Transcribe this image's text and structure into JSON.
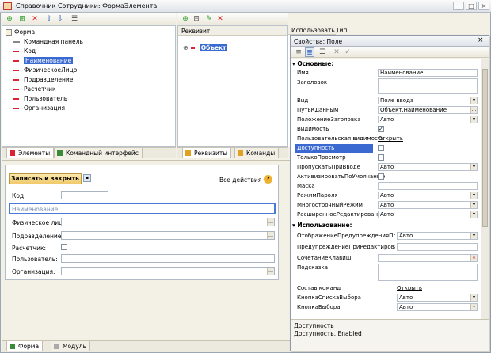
{
  "window": {
    "title": "Справочник Сотрудники: ФормаЭлемента",
    "buttons": [
      "_",
      "□",
      "×"
    ]
  },
  "elements_tree": {
    "root": "Форма",
    "items": [
      {
        "label": "Командная панель",
        "selected": false
      },
      {
        "label": "Код",
        "selected": false
      },
      {
        "label": "Наименование",
        "selected": true
      },
      {
        "label": "ФизическоеЛицо",
        "selected": false
      },
      {
        "label": "Подразделение",
        "selected": false
      },
      {
        "label": "Расчетчик",
        "selected": false
      },
      {
        "label": "Пользователь",
        "selected": false
      },
      {
        "label": "Организация",
        "selected": false
      }
    ]
  },
  "left_tabs": [
    "Элементы",
    "Командный интерфейс"
  ],
  "attributes": {
    "col_requisite": "Реквизит",
    "col_use": "Использовать",
    "col_type": "Тип",
    "item": "Объект"
  },
  "middle_tabs": [
    "Реквизиты",
    "Команды"
  ],
  "preview_form": {
    "save_button": "Записать и закрыть",
    "all_actions": "Все действия",
    "help": "?",
    "fields": [
      {
        "label": "Код:",
        "value": ""
      },
      {
        "label": "Наименование:",
        "value": ""
      },
      {
        "label": "Физическое лицо:",
        "value": ""
      },
      {
        "label": "Подразделение:",
        "value": ""
      },
      {
        "label": "Расчетчик:",
        "value": ""
      },
      {
        "label": "Пользователь:",
        "value": ""
      },
      {
        "label": "Организация:",
        "value": ""
      }
    ]
  },
  "bottom_tabs": [
    "Форма",
    "Модуль"
  ],
  "properties": {
    "title": "Свойства: Поле",
    "section_main": "Основные:",
    "section_use": "Использование:",
    "rows_main": [
      {
        "name": "Имя",
        "kind": "text",
        "value": "Наименование"
      },
      {
        "name": "Заголовок",
        "kind": "multiline",
        "value": ""
      },
      {
        "name": "Вид",
        "kind": "select",
        "value": "Поле ввода"
      },
      {
        "name": "ПутьКДанным",
        "kind": "select",
        "value": "Объект.Наименование"
      },
      {
        "name": "ПоложениеЗаголовка",
        "kind": "select",
        "value": "Авто"
      },
      {
        "name": "Видимость",
        "kind": "check",
        "value": "✓"
      },
      {
        "name": "Пользовательская видимость",
        "kind": "link",
        "value": "Открыть"
      },
      {
        "name": "Доступность",
        "kind": "check",
        "value": "",
        "selected": true
      },
      {
        "name": "ТолькоПросмотр",
        "kind": "check",
        "value": ""
      },
      {
        "name": "ПропускатьПриВводе",
        "kind": "select",
        "value": "Авто"
      },
      {
        "name": "АктивизироватьПоУмолчанию",
        "kind": "check",
        "value": ""
      },
      {
        "name": "Маска",
        "kind": "text",
        "value": ""
      },
      {
        "name": "РежимПароля",
        "kind": "select",
        "value": "Авто"
      },
      {
        "name": "МногострочныйРежим",
        "kind": "select",
        "value": "Авто"
      },
      {
        "name": "РасширенноеРедактирование",
        "kind": "select",
        "value": "Авто"
      }
    ],
    "rows_use": [
      {
        "name": "ОтображениеПредупрежденияПриРед",
        "kind": "select",
        "value": "Авто"
      },
      {
        "name": "ПредупреждениеПриРедактировании",
        "kind": "text",
        "value": ""
      },
      {
        "name": "СочетаниеКлавиш",
        "kind": "clear",
        "value": ""
      },
      {
        "name": "Подсказка",
        "kind": "multiline",
        "value": ""
      },
      {
        "name": "Состав команд",
        "kind": "link",
        "value": "Открыть"
      },
      {
        "name": "КнопкаСпискаВыбора",
        "kind": "select",
        "value": "Авто"
      },
      {
        "name": "КнопкаВыбора",
        "kind": "select",
        "value": "Авто"
      }
    ],
    "status_title": "Доступность",
    "status_text": "Доступность, Enabled"
  },
  "colors": {
    "selection": "#3a6ad1",
    "accent_red": "#d22233",
    "save_button": "#f5d98a"
  }
}
